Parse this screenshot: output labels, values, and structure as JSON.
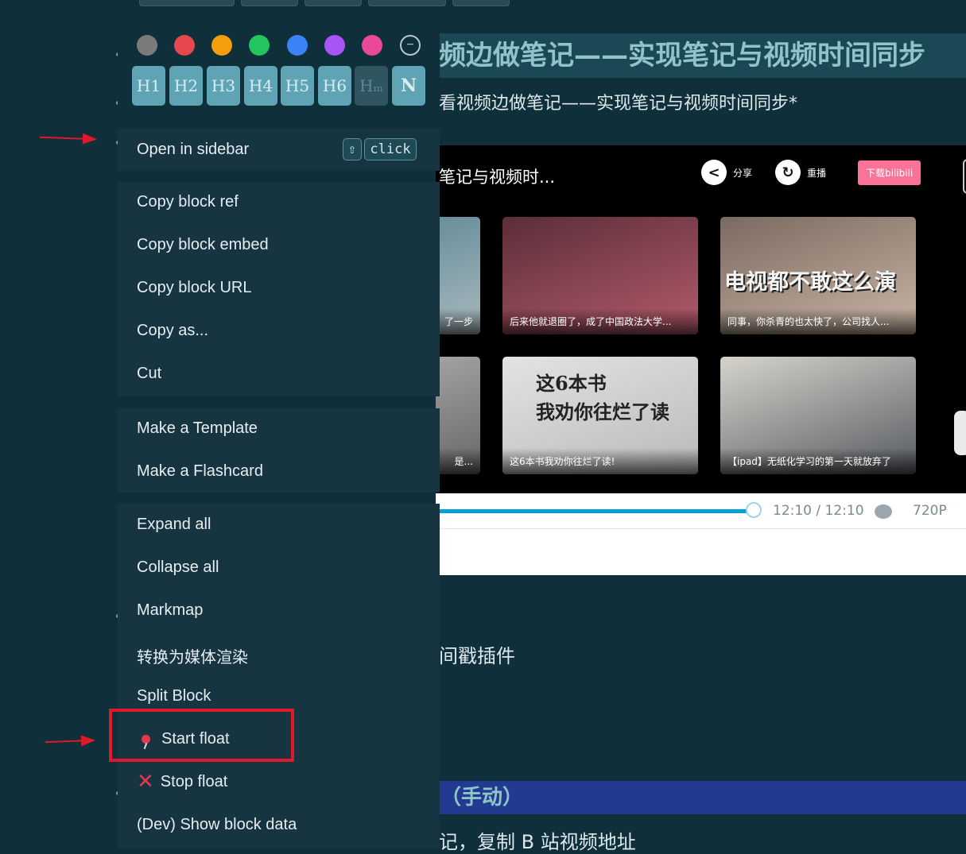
{
  "page": {
    "title": "频边做笔记——实现笔记与视频时间同步",
    "subtitle": "看视频边做笔记——实现笔记与视频时间同步*",
    "plugin_text": "间戳插件",
    "section_heading": "（手动）",
    "bottom_text": "记，复制 B 站视频地址"
  },
  "video": {
    "title": "笔记与视频时...",
    "share_label": "分享",
    "replay_label": "重播",
    "download_label": "下载bilibili",
    "thumbs": [
      {
        "caption": "了一步",
        "big_text": ""
      },
      {
        "caption": "后来他就退圈了，成了中国政法大学...",
        "big_text": ""
      },
      {
        "caption": "同事，你杀青的也太快了，公司找人...",
        "big_text": "电视都不敢这么演"
      },
      {
        "caption": "是...",
        "big_text": ""
      },
      {
        "caption": "这6本书我劝你往烂了读!",
        "big_text": "这6本书\n我劝你往烂了读"
      },
      {
        "caption": "【ipad】无纸化学习的第一天就放弃了",
        "big_text": ""
      }
    ],
    "progress": 1.0,
    "time_current": "12:10",
    "time_separator": "/",
    "time_total": "12:10",
    "quality": "720P"
  },
  "menu": {
    "colors": [
      "#7a7a7a",
      "#e5484d",
      "#f59e0b",
      "#22c55e",
      "#3b82f6",
      "#a855f7",
      "#ec4899"
    ],
    "none_color_label": "−",
    "heading_buttons": [
      "H1",
      "H2",
      "H3",
      "H4",
      "H5",
      "H6",
      "Hₘ",
      "N"
    ],
    "open_in_sidebar": "Open in sidebar",
    "shortcut_shift": "⇧",
    "shortcut_click": "click",
    "copy_group": [
      "Copy block ref",
      "Copy block embed",
      "Copy block URL",
      "Copy as...",
      "Cut"
    ],
    "template_group": [
      "Make a Template",
      "Make a Flashcard"
    ],
    "tools_group": [
      "Expand all",
      "Collapse all",
      "Markmap",
      "转换为媒体渲染",
      "Split Block"
    ],
    "start_float": "Start float",
    "stop_float": "Stop float",
    "dev_show": "(Dev) Show block data"
  }
}
